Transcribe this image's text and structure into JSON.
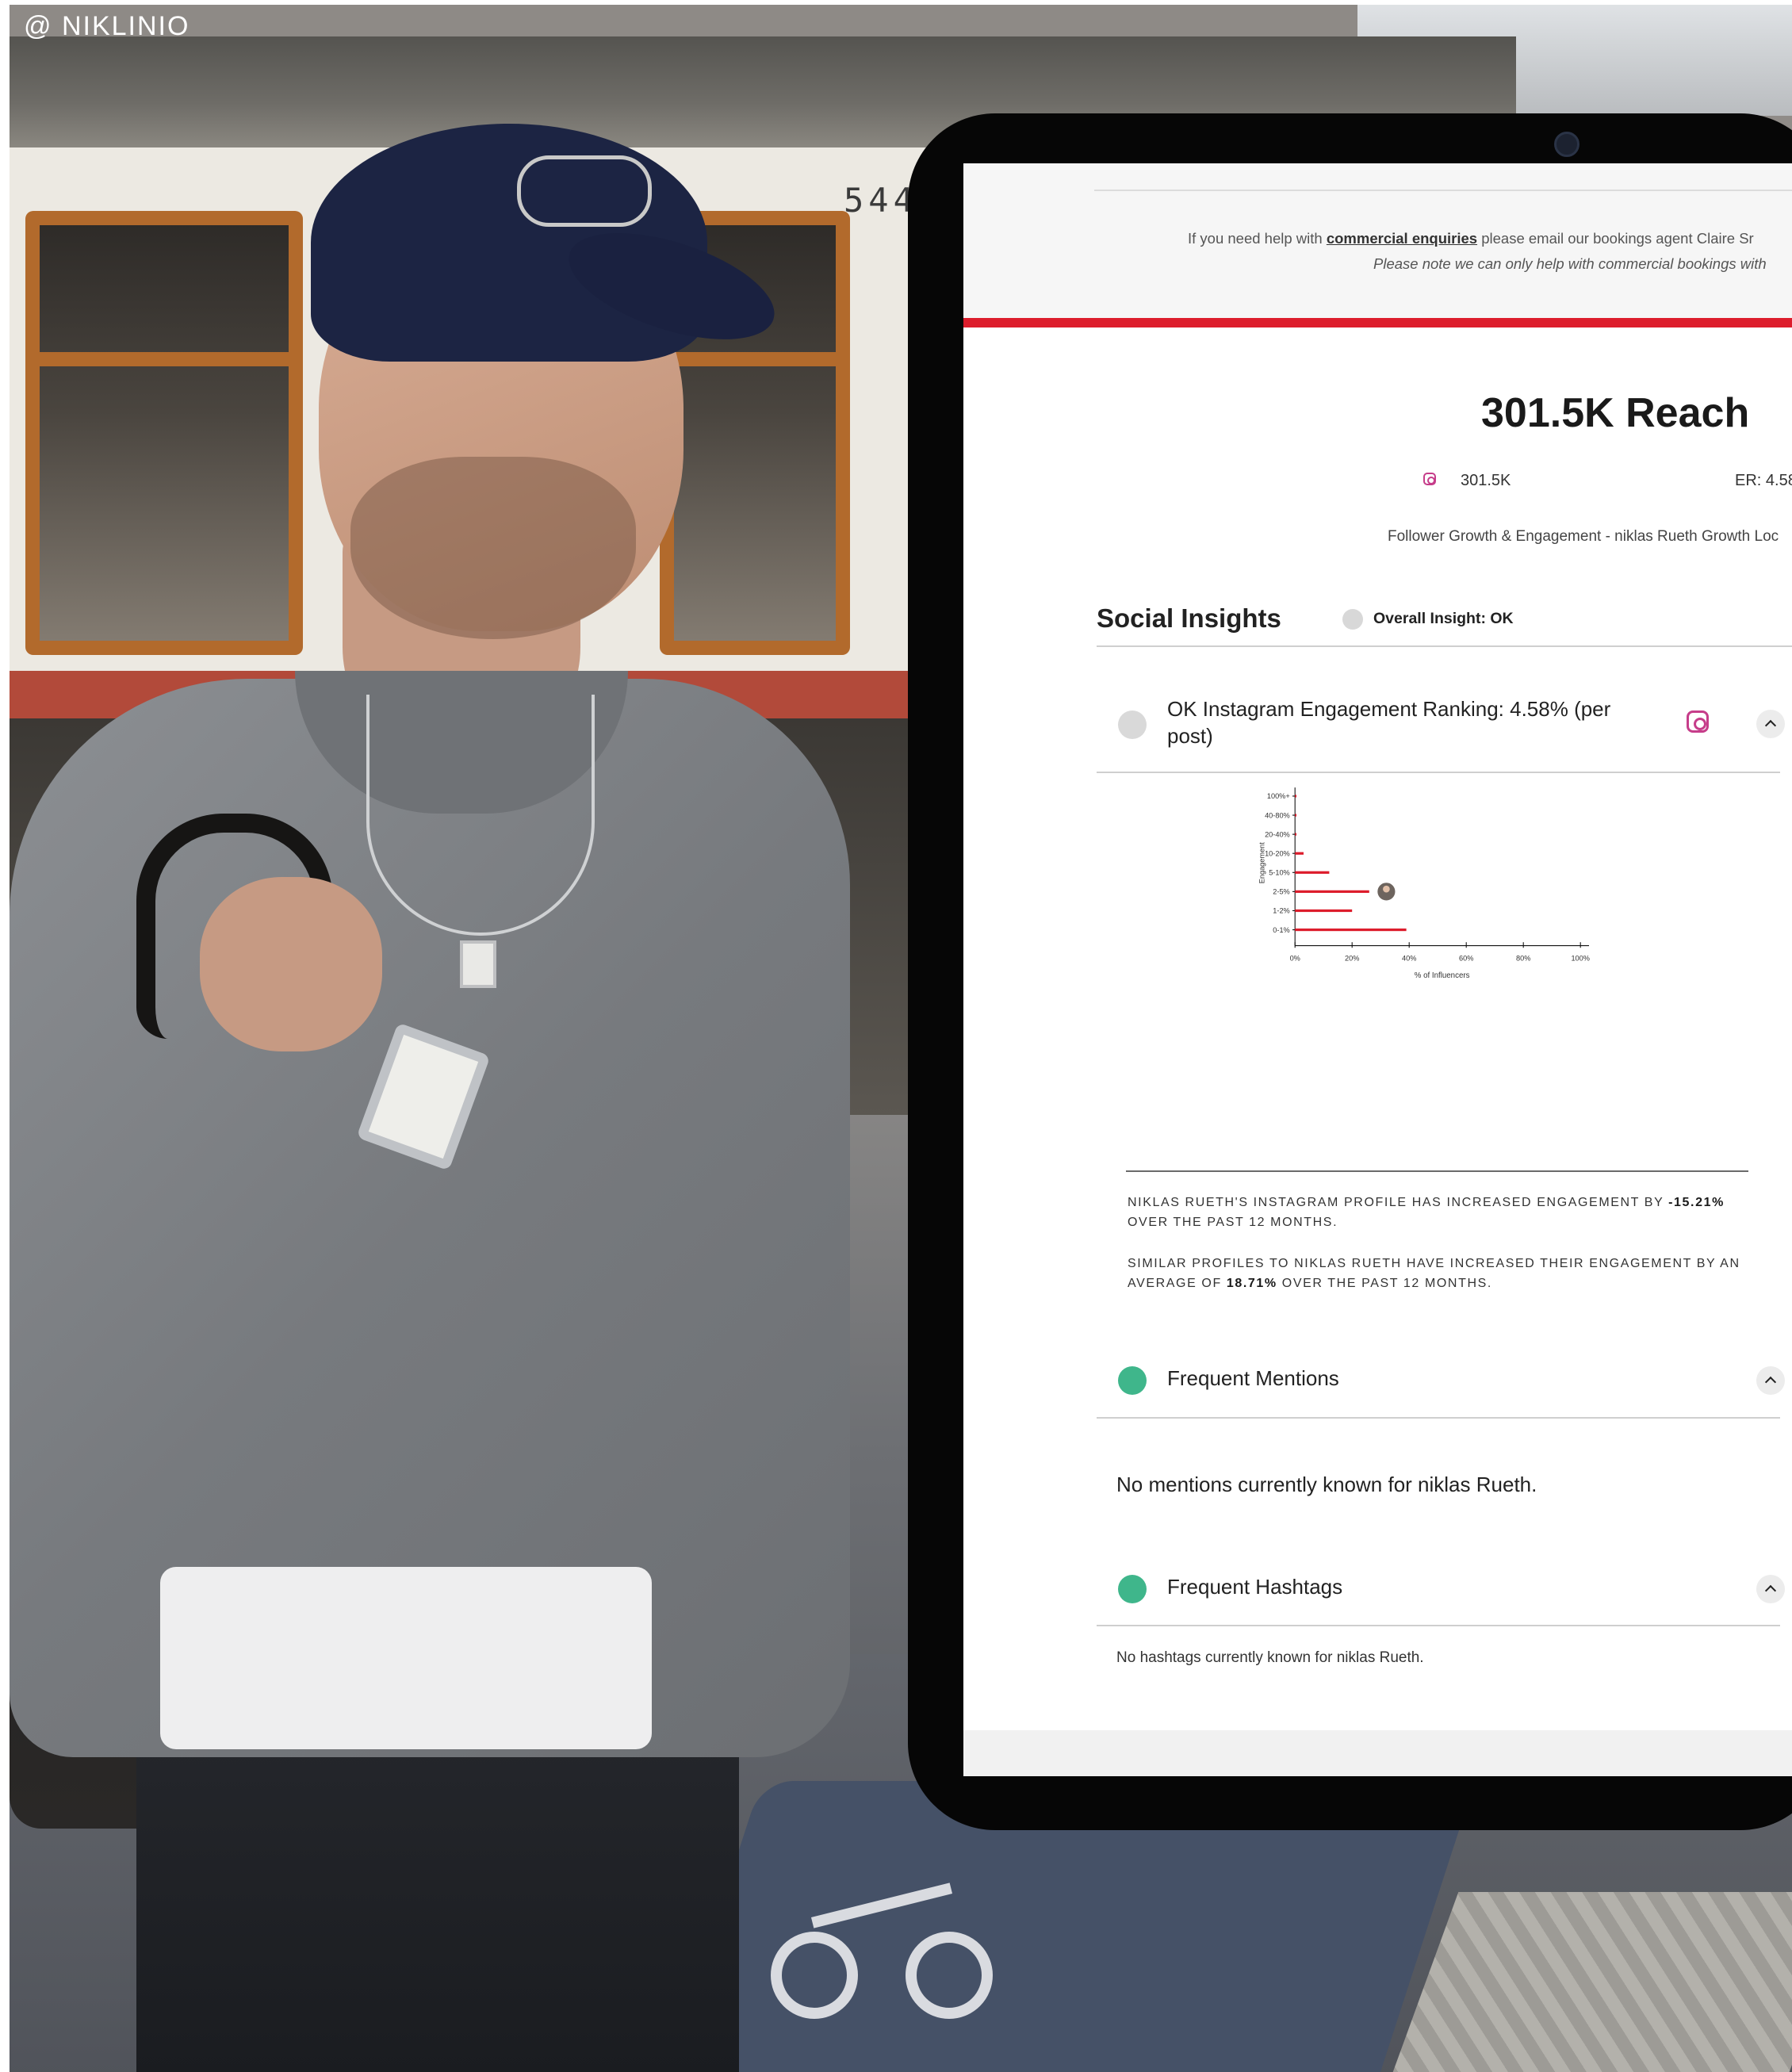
{
  "watermark": "@ NIKLINIO",
  "tram": {
    "number": "544"
  },
  "notice": {
    "line1_prefix": "If you need help with ",
    "line1_link": "commercial enquiries",
    "line1_suffix": " please email our bookings agent Claire Sr",
    "line2": "Please note we can only help with commercial bookings with"
  },
  "reach": {
    "title": "301.5K Reach",
    "instagram_count": "301.5K",
    "er": "ER: 4.58",
    "growth_link": "Follower Growth & Engagement - niklas Rueth Growth Loc"
  },
  "social_insights": {
    "title": "Social Insights",
    "overall": "Overall Insight: OK"
  },
  "engagement_section": {
    "title": "OK Instagram Engagement Ranking: 4.58% (per post)",
    "stat1_prefix": "Niklas Rueth's Instagram profile has increased engagement by ",
    "stat1_value": "-15.21%",
    "stat1_suffix": " over the past 12 months.",
    "stat2_prefix": "Similar profiles to niklas Rueth have increased their engagement by an average of ",
    "stat2_value": "18.71%",
    "stat2_suffix": " over the past 12 months."
  },
  "chart_data": {
    "type": "bar",
    "orientation": "horizontal",
    "title": "",
    "xlabel": "% of Influencers",
    "ylabel": "Engagement",
    "categories": [
      "100%+",
      "40-80%",
      "20-40%",
      "10-20%",
      "5-10%",
      "2-5%",
      "1-2%",
      "0-1%"
    ],
    "values": [
      0.5,
      0.5,
      0.5,
      3,
      12,
      26,
      20,
      39
    ],
    "xlim": [
      -2,
      103
    ],
    "xticks": [
      0,
      20,
      40,
      60,
      80,
      100
    ],
    "xtick_labels": [
      "0%",
      "20%",
      "40%",
      "60%",
      "80%",
      "100%"
    ],
    "highlight_category": "2-5%",
    "highlight_x": 32,
    "bar_color": "#dd1d2c",
    "grid": false,
    "legend": "none"
  },
  "mentions_section": {
    "title": "Frequent Mentions",
    "empty": "No mentions currently known for niklas Rueth."
  },
  "hashtags_section": {
    "title": "Frequent Hashtags",
    "empty": "No hashtags currently known for niklas Rueth."
  },
  "colors": {
    "accent_red": "#dd1d2c",
    "status_ok": "#d9d9d9",
    "status_good": "#3fb68b",
    "instagram": "#c63d8a"
  }
}
